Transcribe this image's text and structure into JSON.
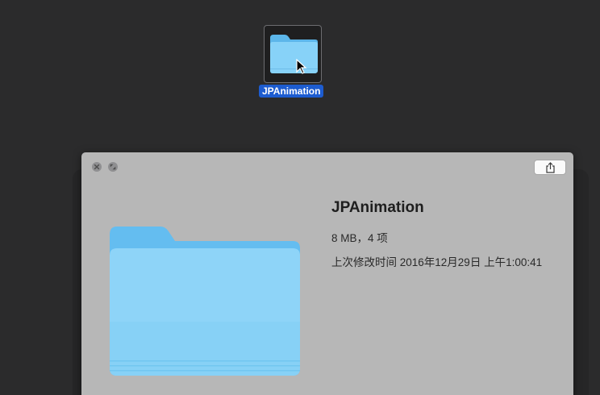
{
  "desktop": {
    "selected_item": {
      "label": "JPAnimation",
      "icon": "folder-icon",
      "selection_color": "#1d5cd0"
    }
  },
  "quicklook": {
    "title_buttons": {
      "close": "close-icon",
      "fullscreen": "fullscreen-icon"
    },
    "share_icon": "share-icon",
    "preview_icon": "folder-icon",
    "file_name": "JPAnimation",
    "size_and_count": "8 MB，4 项",
    "modified": "上次修改时间 2016年12月29日 上午1:00:41"
  },
  "colors": {
    "folder_blue": "#7fcdf6",
    "window_bg": "#b7b7b7",
    "desktop_bg": "#2b2b2c"
  }
}
